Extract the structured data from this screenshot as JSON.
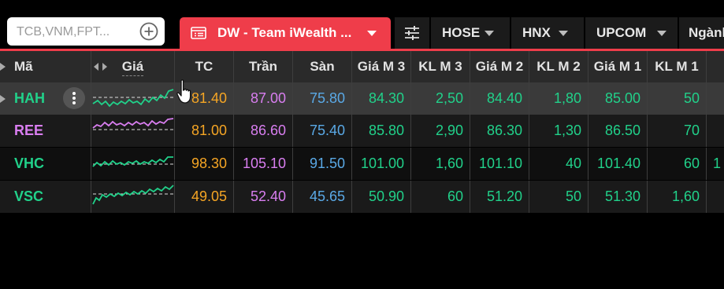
{
  "search": {
    "placeholder": "TCB,VNM,FPT..."
  },
  "watchlist_tab": {
    "label": "DW - Team iWealth ..."
  },
  "market_tabs": [
    {
      "label": "HOSE"
    },
    {
      "label": "HNX"
    },
    {
      "label": "UPCOM"
    },
    {
      "label": "Ngành"
    }
  ],
  "colors": {
    "accent": "#ef3d4a",
    "reference": "#f5a524",
    "ceiling": "#d97ef0",
    "floor": "#5aa9e6",
    "up": "#21d18a"
  },
  "table": {
    "headers": [
      "Mã",
      "Giá",
      "TC",
      "Trần",
      "Sàn",
      "Giá M 3",
      "KL M 3",
      "Giá M 2",
      "KL M 2",
      "Giá M 1",
      "KL M 1"
    ],
    "rows": [
      {
        "symbol": "HAH",
        "tc": "81.40",
        "tran": "87.00",
        "san": "75.80",
        "gia_m3": "84.30",
        "kl_m3": "2,50",
        "gia_m2": "84.40",
        "kl_m2": "1,80",
        "gia_m1": "85.00",
        "kl_m1": "50",
        "overflow": ""
      },
      {
        "symbol": "REE",
        "tc": "81.00",
        "tran": "86.60",
        "san": "75.40",
        "gia_m3": "85.80",
        "kl_m3": "2,90",
        "gia_m2": "86.30",
        "kl_m2": "1,30",
        "gia_m1": "86.50",
        "kl_m1": "70",
        "overflow": ""
      },
      {
        "symbol": "VHC",
        "tc": "98.30",
        "tran": "105.10",
        "san": "91.50",
        "gia_m3": "101.00",
        "kl_m3": "1,60",
        "gia_m2": "101.10",
        "kl_m2": "40",
        "gia_m1": "101.40",
        "kl_m1": "60",
        "overflow": "1"
      },
      {
        "symbol": "VSC",
        "tc": "49.05",
        "tran": "52.40",
        "san": "45.65",
        "gia_m3": "50.90",
        "kl_m3": "60",
        "gia_m2": "51.20",
        "kl_m2": "50",
        "gia_m1": "51.30",
        "kl_m1": "1,60",
        "overflow": ""
      }
    ]
  }
}
